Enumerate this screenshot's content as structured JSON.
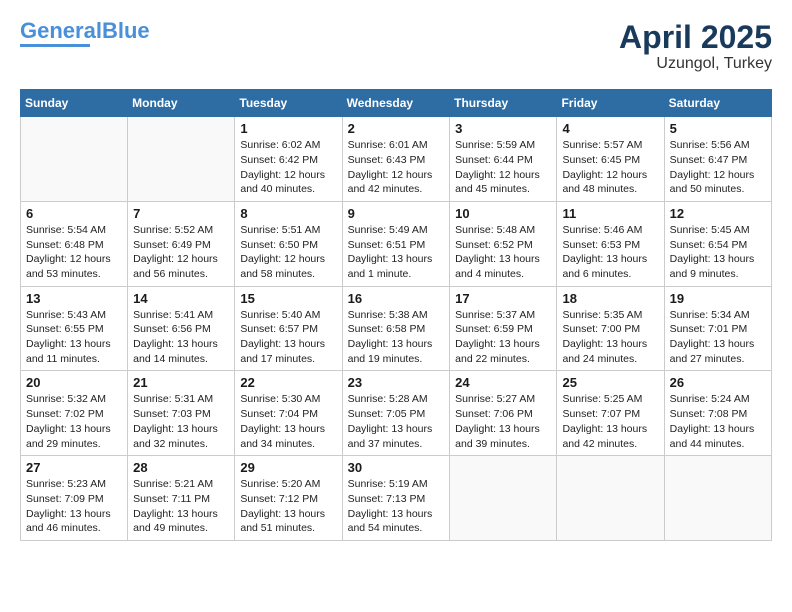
{
  "header": {
    "logo_line1a": "General",
    "logo_line1b": "Blue",
    "title": "April 2025",
    "subtitle": "Uzungol, Turkey"
  },
  "days_of_week": [
    "Sunday",
    "Monday",
    "Tuesday",
    "Wednesday",
    "Thursday",
    "Friday",
    "Saturday"
  ],
  "weeks": [
    [
      {
        "day": "",
        "content": ""
      },
      {
        "day": "",
        "content": ""
      },
      {
        "day": "1",
        "content": "Sunrise: 6:02 AM\nSunset: 6:42 PM\nDaylight: 12 hours\nand 40 minutes."
      },
      {
        "day": "2",
        "content": "Sunrise: 6:01 AM\nSunset: 6:43 PM\nDaylight: 12 hours\nand 42 minutes."
      },
      {
        "day": "3",
        "content": "Sunrise: 5:59 AM\nSunset: 6:44 PM\nDaylight: 12 hours\nand 45 minutes."
      },
      {
        "day": "4",
        "content": "Sunrise: 5:57 AM\nSunset: 6:45 PM\nDaylight: 12 hours\nand 48 minutes."
      },
      {
        "day": "5",
        "content": "Sunrise: 5:56 AM\nSunset: 6:47 PM\nDaylight: 12 hours\nand 50 minutes."
      }
    ],
    [
      {
        "day": "6",
        "content": "Sunrise: 5:54 AM\nSunset: 6:48 PM\nDaylight: 12 hours\nand 53 minutes."
      },
      {
        "day": "7",
        "content": "Sunrise: 5:52 AM\nSunset: 6:49 PM\nDaylight: 12 hours\nand 56 minutes."
      },
      {
        "day": "8",
        "content": "Sunrise: 5:51 AM\nSunset: 6:50 PM\nDaylight: 12 hours\nand 58 minutes."
      },
      {
        "day": "9",
        "content": "Sunrise: 5:49 AM\nSunset: 6:51 PM\nDaylight: 13 hours\nand 1 minute."
      },
      {
        "day": "10",
        "content": "Sunrise: 5:48 AM\nSunset: 6:52 PM\nDaylight: 13 hours\nand 4 minutes."
      },
      {
        "day": "11",
        "content": "Sunrise: 5:46 AM\nSunset: 6:53 PM\nDaylight: 13 hours\nand 6 minutes."
      },
      {
        "day": "12",
        "content": "Sunrise: 5:45 AM\nSunset: 6:54 PM\nDaylight: 13 hours\nand 9 minutes."
      }
    ],
    [
      {
        "day": "13",
        "content": "Sunrise: 5:43 AM\nSunset: 6:55 PM\nDaylight: 13 hours\nand 11 minutes."
      },
      {
        "day": "14",
        "content": "Sunrise: 5:41 AM\nSunset: 6:56 PM\nDaylight: 13 hours\nand 14 minutes."
      },
      {
        "day": "15",
        "content": "Sunrise: 5:40 AM\nSunset: 6:57 PM\nDaylight: 13 hours\nand 17 minutes."
      },
      {
        "day": "16",
        "content": "Sunrise: 5:38 AM\nSunset: 6:58 PM\nDaylight: 13 hours\nand 19 minutes."
      },
      {
        "day": "17",
        "content": "Sunrise: 5:37 AM\nSunset: 6:59 PM\nDaylight: 13 hours\nand 22 minutes."
      },
      {
        "day": "18",
        "content": "Sunrise: 5:35 AM\nSunset: 7:00 PM\nDaylight: 13 hours\nand 24 minutes."
      },
      {
        "day": "19",
        "content": "Sunrise: 5:34 AM\nSunset: 7:01 PM\nDaylight: 13 hours\nand 27 minutes."
      }
    ],
    [
      {
        "day": "20",
        "content": "Sunrise: 5:32 AM\nSunset: 7:02 PM\nDaylight: 13 hours\nand 29 minutes."
      },
      {
        "day": "21",
        "content": "Sunrise: 5:31 AM\nSunset: 7:03 PM\nDaylight: 13 hours\nand 32 minutes."
      },
      {
        "day": "22",
        "content": "Sunrise: 5:30 AM\nSunset: 7:04 PM\nDaylight: 13 hours\nand 34 minutes."
      },
      {
        "day": "23",
        "content": "Sunrise: 5:28 AM\nSunset: 7:05 PM\nDaylight: 13 hours\nand 37 minutes."
      },
      {
        "day": "24",
        "content": "Sunrise: 5:27 AM\nSunset: 7:06 PM\nDaylight: 13 hours\nand 39 minutes."
      },
      {
        "day": "25",
        "content": "Sunrise: 5:25 AM\nSunset: 7:07 PM\nDaylight: 13 hours\nand 42 minutes."
      },
      {
        "day": "26",
        "content": "Sunrise: 5:24 AM\nSunset: 7:08 PM\nDaylight: 13 hours\nand 44 minutes."
      }
    ],
    [
      {
        "day": "27",
        "content": "Sunrise: 5:23 AM\nSunset: 7:09 PM\nDaylight: 13 hours\nand 46 minutes."
      },
      {
        "day": "28",
        "content": "Sunrise: 5:21 AM\nSunset: 7:11 PM\nDaylight: 13 hours\nand 49 minutes."
      },
      {
        "day": "29",
        "content": "Sunrise: 5:20 AM\nSunset: 7:12 PM\nDaylight: 13 hours\nand 51 minutes."
      },
      {
        "day": "30",
        "content": "Sunrise: 5:19 AM\nSunset: 7:13 PM\nDaylight: 13 hours\nand 54 minutes."
      },
      {
        "day": "",
        "content": ""
      },
      {
        "day": "",
        "content": ""
      },
      {
        "day": "",
        "content": ""
      }
    ]
  ]
}
